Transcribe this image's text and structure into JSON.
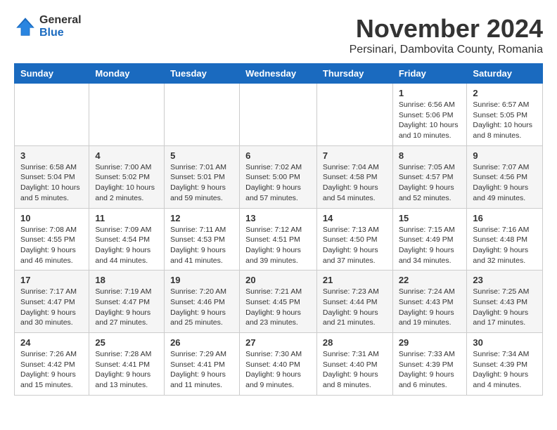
{
  "logo": {
    "general": "General",
    "blue": "Blue"
  },
  "title": "November 2024",
  "location": "Persinari, Dambovita County, Romania",
  "header_days": [
    "Sunday",
    "Monday",
    "Tuesday",
    "Wednesday",
    "Thursday",
    "Friday",
    "Saturday"
  ],
  "weeks": [
    [
      {
        "day": "",
        "info": ""
      },
      {
        "day": "",
        "info": ""
      },
      {
        "day": "",
        "info": ""
      },
      {
        "day": "",
        "info": ""
      },
      {
        "day": "",
        "info": ""
      },
      {
        "day": "1",
        "info": "Sunrise: 6:56 AM\nSunset: 5:06 PM\nDaylight: 10 hours and 10 minutes."
      },
      {
        "day": "2",
        "info": "Sunrise: 6:57 AM\nSunset: 5:05 PM\nDaylight: 10 hours and 8 minutes."
      }
    ],
    [
      {
        "day": "3",
        "info": "Sunrise: 6:58 AM\nSunset: 5:04 PM\nDaylight: 10 hours and 5 minutes."
      },
      {
        "day": "4",
        "info": "Sunrise: 7:00 AM\nSunset: 5:02 PM\nDaylight: 10 hours and 2 minutes."
      },
      {
        "day": "5",
        "info": "Sunrise: 7:01 AM\nSunset: 5:01 PM\nDaylight: 9 hours and 59 minutes."
      },
      {
        "day": "6",
        "info": "Sunrise: 7:02 AM\nSunset: 5:00 PM\nDaylight: 9 hours and 57 minutes."
      },
      {
        "day": "7",
        "info": "Sunrise: 7:04 AM\nSunset: 4:58 PM\nDaylight: 9 hours and 54 minutes."
      },
      {
        "day": "8",
        "info": "Sunrise: 7:05 AM\nSunset: 4:57 PM\nDaylight: 9 hours and 52 minutes."
      },
      {
        "day": "9",
        "info": "Sunrise: 7:07 AM\nSunset: 4:56 PM\nDaylight: 9 hours and 49 minutes."
      }
    ],
    [
      {
        "day": "10",
        "info": "Sunrise: 7:08 AM\nSunset: 4:55 PM\nDaylight: 9 hours and 46 minutes."
      },
      {
        "day": "11",
        "info": "Sunrise: 7:09 AM\nSunset: 4:54 PM\nDaylight: 9 hours and 44 minutes."
      },
      {
        "day": "12",
        "info": "Sunrise: 7:11 AM\nSunset: 4:53 PM\nDaylight: 9 hours and 41 minutes."
      },
      {
        "day": "13",
        "info": "Sunrise: 7:12 AM\nSunset: 4:51 PM\nDaylight: 9 hours and 39 minutes."
      },
      {
        "day": "14",
        "info": "Sunrise: 7:13 AM\nSunset: 4:50 PM\nDaylight: 9 hours and 37 minutes."
      },
      {
        "day": "15",
        "info": "Sunrise: 7:15 AM\nSunset: 4:49 PM\nDaylight: 9 hours and 34 minutes."
      },
      {
        "day": "16",
        "info": "Sunrise: 7:16 AM\nSunset: 4:48 PM\nDaylight: 9 hours and 32 minutes."
      }
    ],
    [
      {
        "day": "17",
        "info": "Sunrise: 7:17 AM\nSunset: 4:47 PM\nDaylight: 9 hours and 30 minutes."
      },
      {
        "day": "18",
        "info": "Sunrise: 7:19 AM\nSunset: 4:47 PM\nDaylight: 9 hours and 27 minutes."
      },
      {
        "day": "19",
        "info": "Sunrise: 7:20 AM\nSunset: 4:46 PM\nDaylight: 9 hours and 25 minutes."
      },
      {
        "day": "20",
        "info": "Sunrise: 7:21 AM\nSunset: 4:45 PM\nDaylight: 9 hours and 23 minutes."
      },
      {
        "day": "21",
        "info": "Sunrise: 7:23 AM\nSunset: 4:44 PM\nDaylight: 9 hours and 21 minutes."
      },
      {
        "day": "22",
        "info": "Sunrise: 7:24 AM\nSunset: 4:43 PM\nDaylight: 9 hours and 19 minutes."
      },
      {
        "day": "23",
        "info": "Sunrise: 7:25 AM\nSunset: 4:43 PM\nDaylight: 9 hours and 17 minutes."
      }
    ],
    [
      {
        "day": "24",
        "info": "Sunrise: 7:26 AM\nSunset: 4:42 PM\nDaylight: 9 hours and 15 minutes."
      },
      {
        "day": "25",
        "info": "Sunrise: 7:28 AM\nSunset: 4:41 PM\nDaylight: 9 hours and 13 minutes."
      },
      {
        "day": "26",
        "info": "Sunrise: 7:29 AM\nSunset: 4:41 PM\nDaylight: 9 hours and 11 minutes."
      },
      {
        "day": "27",
        "info": "Sunrise: 7:30 AM\nSunset: 4:40 PM\nDaylight: 9 hours and 9 minutes."
      },
      {
        "day": "28",
        "info": "Sunrise: 7:31 AM\nSunset: 4:40 PM\nDaylight: 9 hours and 8 minutes."
      },
      {
        "day": "29",
        "info": "Sunrise: 7:33 AM\nSunset: 4:39 PM\nDaylight: 9 hours and 6 minutes."
      },
      {
        "day": "30",
        "info": "Sunrise: 7:34 AM\nSunset: 4:39 PM\nDaylight: 9 hours and 4 minutes."
      }
    ]
  ]
}
